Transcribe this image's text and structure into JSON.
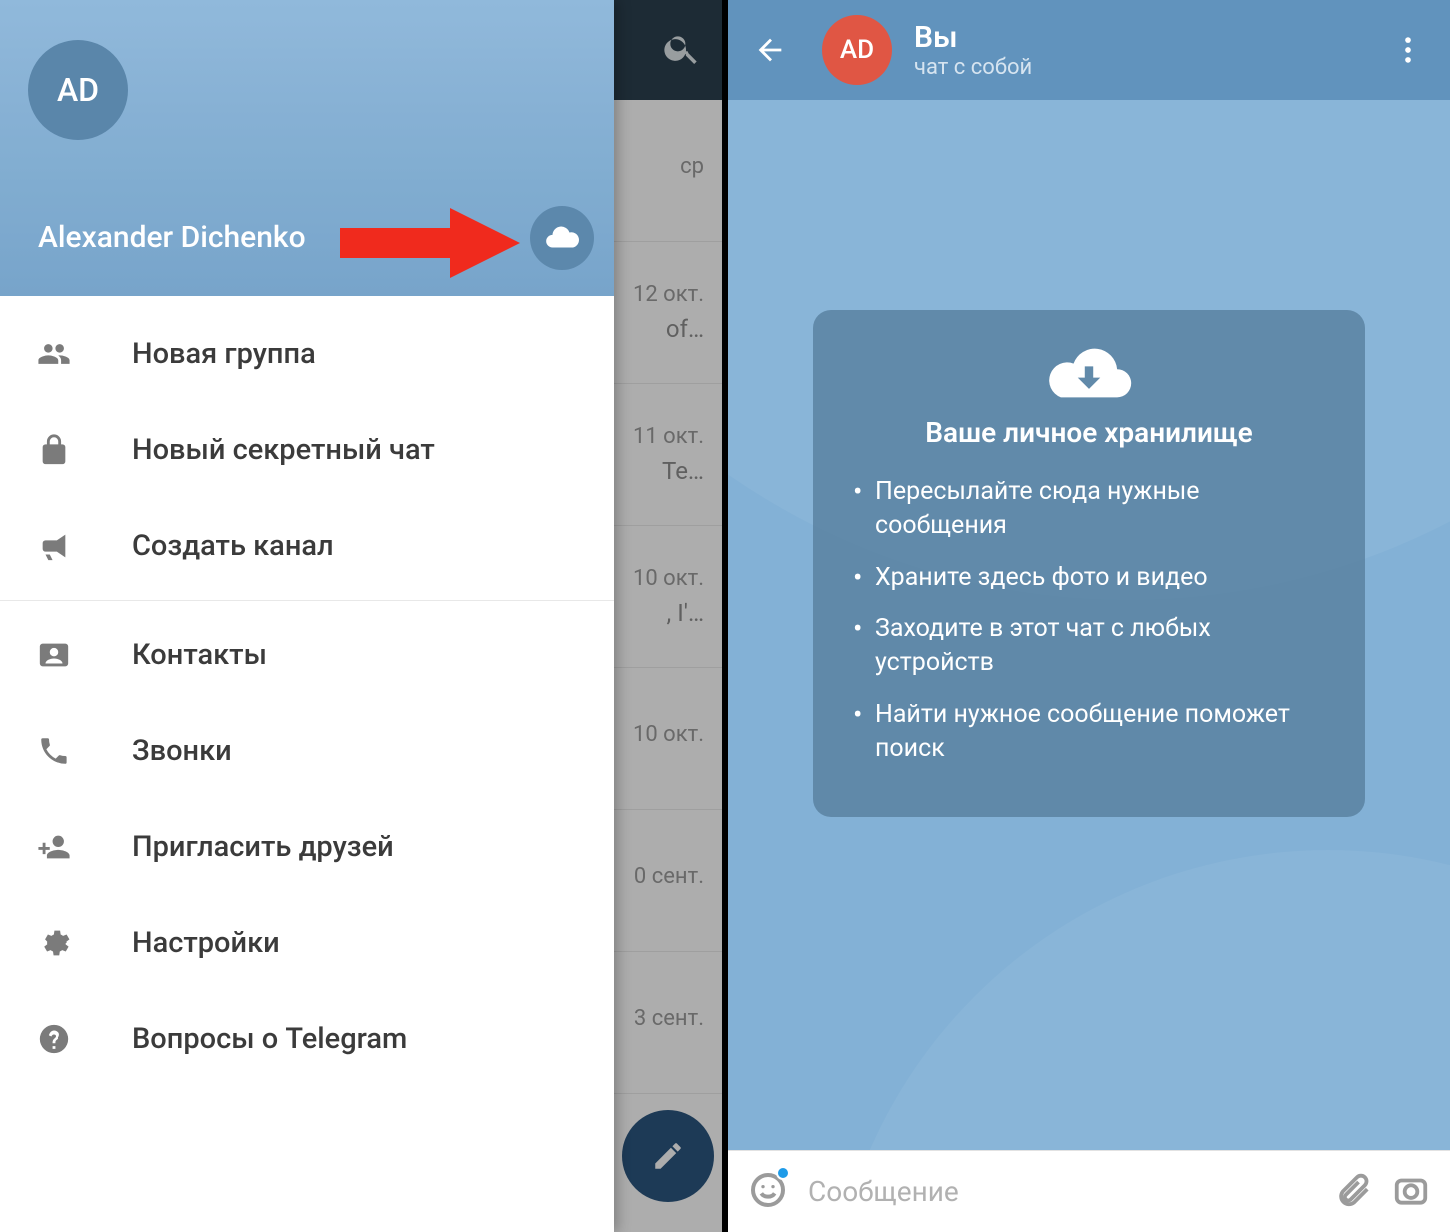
{
  "left": {
    "avatar_initials": "AD",
    "user_name": "Alexander Dichenko",
    "menu": {
      "new_group": "Новая группа",
      "new_secret": "Новый секретный чат",
      "create_channel": "Создать канал",
      "contacts": "Контакты",
      "calls": "Звонки",
      "invite": "Пригласить друзей",
      "settings": "Настройки",
      "faq": "Вопросы о Telegram"
    },
    "chatlist_peek": {
      "rows": [
        {
          "date": "ср",
          "snip": ""
        },
        {
          "date": "12 окт.",
          "snip": "of…"
        },
        {
          "date": "11 окт.",
          "snip": "Те…"
        },
        {
          "date": "10 окт.",
          "snip": ", I'…"
        },
        {
          "date": "10 окт.",
          "snip": ""
        },
        {
          "date": "0 сент.",
          "snip": ""
        },
        {
          "date": "3 сент.",
          "snip": ""
        }
      ]
    }
  },
  "right": {
    "avatar_initials": "AD",
    "title": "Вы",
    "subtitle": "чат с собой",
    "card": {
      "title": "Ваше личное хранилище",
      "items": [
        "Пересылайте сюда нужные сообщения",
        "Храните здесь фото и видео",
        "Заходите в этот чат с любых устройств",
        "Найти нужное сообщение поможет поиск"
      ]
    },
    "input_placeholder": "Сообщение"
  },
  "colors": {
    "brand_blue": "#6193bd",
    "accent_red": "#e05644"
  }
}
